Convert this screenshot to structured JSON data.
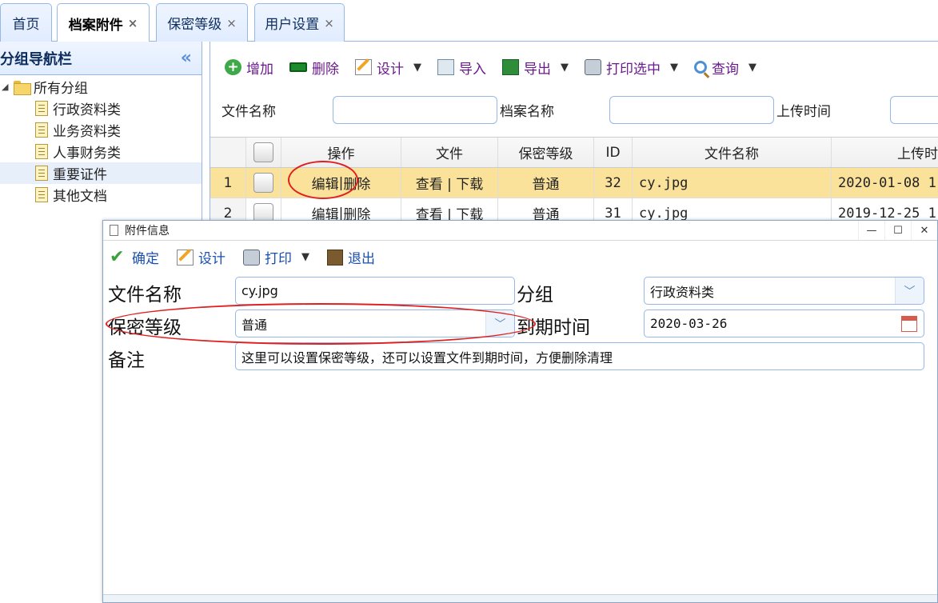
{
  "tabs": [
    {
      "label": "首页",
      "closable": false,
      "active": false
    },
    {
      "label": "档案附件",
      "closable": true,
      "active": true
    },
    {
      "label": "保密等级",
      "closable": true,
      "active": false
    },
    {
      "label": "用户设置",
      "closable": true,
      "active": false
    }
  ],
  "close_glyph": "×",
  "sidebar": {
    "title": "分组导航栏",
    "collapse_glyph": "«",
    "root": "所有分组",
    "items": [
      "行政资料类",
      "业务资料类",
      "人事财务类",
      "重要证件",
      "其他文档"
    ],
    "selected_index": 3
  },
  "toolbar": {
    "add": "增加",
    "delete": "删除",
    "design": "设计",
    "import": "导入",
    "export": "导出",
    "print_selected": "打印选中",
    "query": "查询"
  },
  "filters": {
    "file_name": "文件名称",
    "archive_name": "档案名称",
    "upload_time": "上传时间"
  },
  "grid": {
    "columns": [
      "操作",
      "文件",
      "保密等级",
      "ID",
      "文件名称",
      "上传时"
    ],
    "rows": [
      {
        "num": "1",
        "op_edit": "编辑",
        "op_sep": "|",
        "op_delete": "删除",
        "file": "查看 | 下载",
        "level": "普通",
        "id": "32",
        "name": "cy.jpg",
        "time": "2020-01-08 1"
      },
      {
        "num": "2",
        "op_edit": "编辑",
        "op_sep": "|",
        "op_delete": "删除",
        "file": "查看 | 下载",
        "level": "普通",
        "id": "31",
        "name": "cy.jpg",
        "time": "2019-12-25 1("
      }
    ]
  },
  "dialog": {
    "title": "附件信息",
    "win_min": "—",
    "win_max": "☐",
    "win_close": "✕",
    "toolbar": {
      "confirm": "确定",
      "design": "设计",
      "print": "打印",
      "exit": "退出"
    },
    "fields": {
      "file_name_label": "文件名称",
      "file_name_value": "cy.jpg",
      "group_label": "分组",
      "group_value": "行政资料类",
      "level_label": "保密等级",
      "level_value": "普通",
      "expire_label": "到期时间",
      "expire_value": "2020-03-26",
      "remark_label": "备注",
      "remark_value": "这里可以设置保密等级，还可以设置文件到期时间，方便删除清理"
    }
  },
  "colors": {
    "accent_border": "#95b8e7",
    "selected_row": "#fbe29b",
    "annotation": "#e02020",
    "toolbar_text": "#6a1a8c"
  }
}
